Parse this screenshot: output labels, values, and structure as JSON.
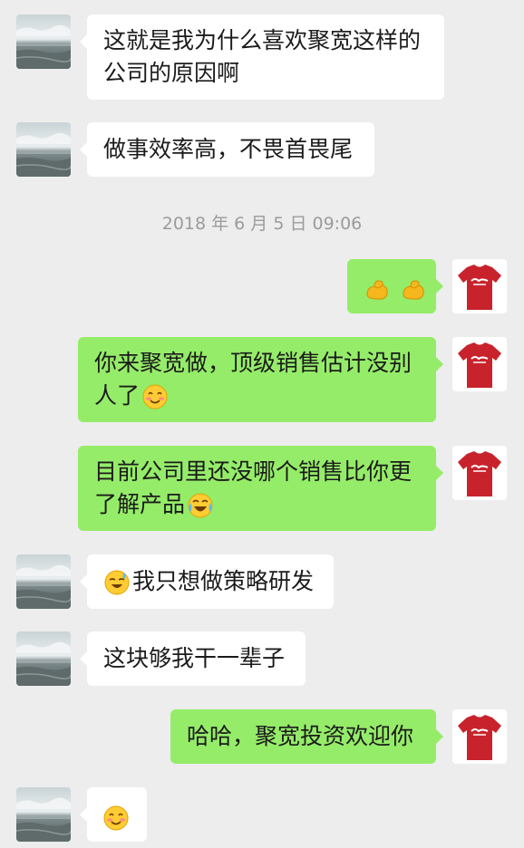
{
  "chat": {
    "timestamp": "2018 年 6 月 5 日 09:06",
    "messages": [
      {
        "side": "left",
        "lines": [
          "这就是我为什么喜欢聚宽这样的",
          "公司的原因啊"
        ]
      },
      {
        "side": "left",
        "lines": [
          "做事效率高，不畏首畏尾"
        ]
      },
      {
        "side": "right",
        "emoji": [
          "muscle-emoji",
          "muscle-emoji"
        ]
      },
      {
        "side": "right",
        "lines": [
          "你来聚宽做，顶级销售估计没别",
          "人了"
        ],
        "trailing_emoji": "blush-emoji"
      },
      {
        "side": "right",
        "lines": [
          "目前公司里还没哪个销售比你更",
          "了解产品"
        ],
        "trailing_emoji": "tears-of-joy-emoji"
      },
      {
        "side": "left",
        "lines": [
          "我只想做策略研发"
        ],
        "leading_emoji": "sweating-laugh-emoji"
      },
      {
        "side": "left",
        "lines": [
          "这块够我干一辈子"
        ]
      },
      {
        "side": "right",
        "lines": [
          "哈哈，聚宽投资欢迎你"
        ]
      },
      {
        "side": "left",
        "emoji": [
          "blush-emoji"
        ]
      }
    ]
  },
  "colors": {
    "background": "#ededed",
    "incoming_bubble": "#ffffff",
    "outgoing_bubble": "#95ec69",
    "shirt_red": "#c8232c"
  },
  "avatars": {
    "contact": "sea-landscape-avatar",
    "self": "red-tshirt-avatar"
  }
}
